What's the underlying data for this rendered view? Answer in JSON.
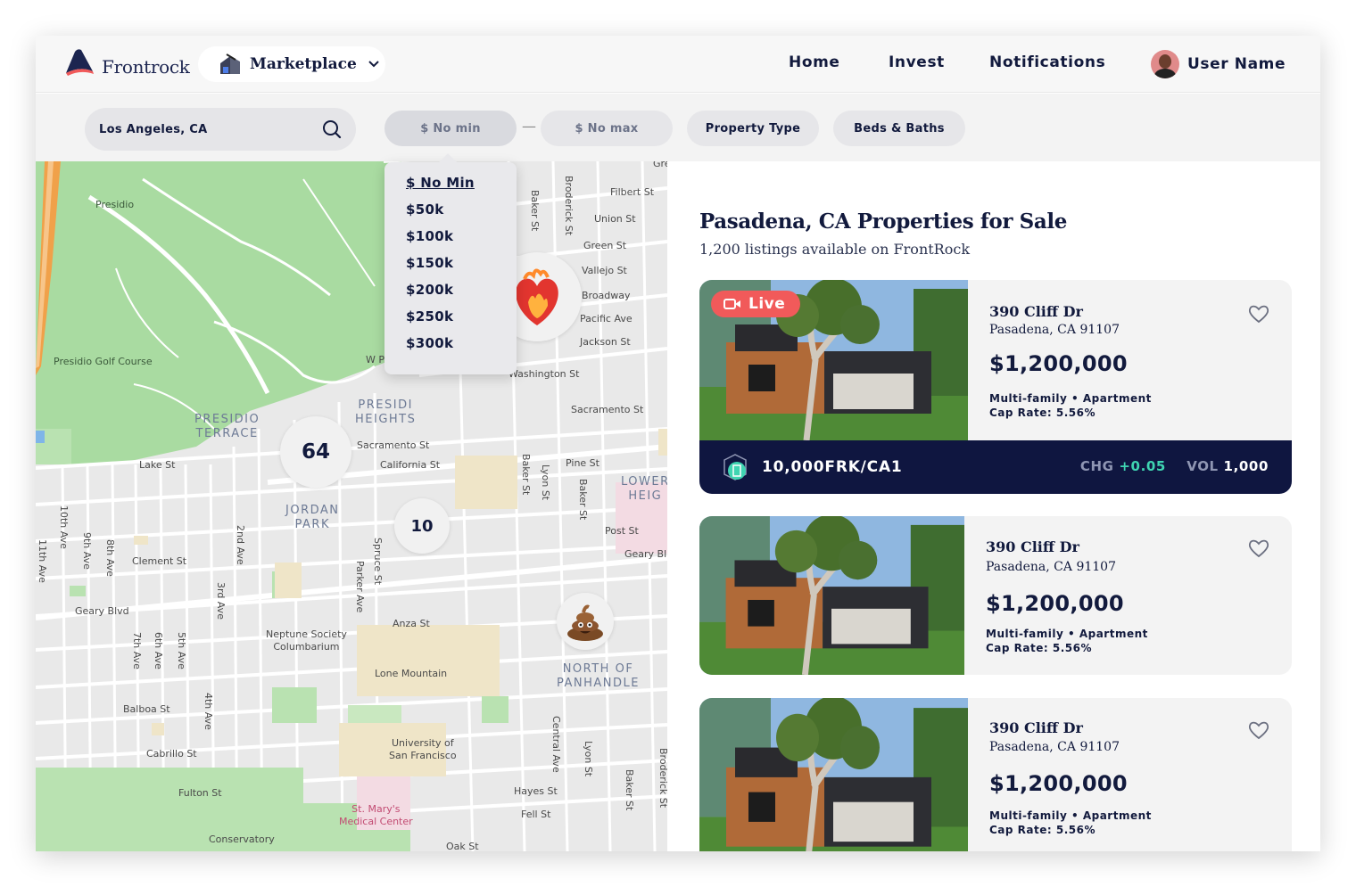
{
  "header": {
    "brand": "Frontrock",
    "marketplace_label": "Marketplace",
    "nav": [
      "Home",
      "Invest",
      "Notifications"
    ],
    "user_name": "User Name"
  },
  "filters": {
    "search_value": "Los Angeles, CA",
    "min_price": "$ No min",
    "max_price": "$ No max",
    "property_type": "Property Type",
    "beds_baths": "Beds & Baths"
  },
  "price_dropdown": {
    "options": [
      "$ No Min",
      "$50k",
      "$100k",
      "$150k",
      "$200k",
      "$250k",
      "$300k"
    ],
    "selected_index": 0
  },
  "map": {
    "clusters": [
      "64",
      "10"
    ],
    "area_labels": {
      "presidio_terrace": "PRESIDIO TERRACE",
      "presidio_heights": "PRESIDIO HEIGHTS",
      "jordan_park": "JORDAN PARK",
      "lower_heights": "LOWER HEIG",
      "north_panhandle": "NORTH OF PANHANDLE"
    },
    "place_labels": {
      "presidio": "Presidio",
      "golf": "Presidio Golf Course",
      "neptune": "Neptune Society Columbarium",
      "lone_mountain": "Lone Mountain",
      "usf": "University of San Francisco",
      "st_marys": "St. Mary's Medical Center",
      "conservatory": "Conservatory"
    },
    "streets": {
      "lake": "Lake St",
      "clement": "Clement St",
      "geary": "Geary Blvd",
      "balboa": "Balboa St",
      "cabrillo": "Cabrillo St",
      "fulton": "Fulton St",
      "california": "California St",
      "sacramento": "Sacramento St",
      "sacramento2": "Sacramento St",
      "washington": "Washington St",
      "jackson": "Jackson St",
      "pacific": "Pacific Ave",
      "broadway": "Broadway",
      "vallejo": "Vallejo St",
      "green": "Green St",
      "union": "Union St",
      "filbert": "Filbert St",
      "pine": "Pine St",
      "post": "Post St",
      "geary2": "Geary Bl",
      "anza": "Anza St",
      "hayes": "Hayes St",
      "fell": "Fell St",
      "oak": "Oak St",
      "wpac": "W P",
      "tenth": "10th Ave",
      "eleventh": "11th Ave",
      "ninth": "9th Ave",
      "eighth": "8th Ave",
      "second": "2nd Ave",
      "third": "3rd Ave",
      "seventh": "7th Ave",
      "sixth": "6th Ave",
      "fifth": "5th Ave",
      "fourth": "4th Ave",
      "spruce": "Spruce St",
      "parker": "Parker Ave",
      "lyon": "Lyon St",
      "baker": "Baker St",
      "lyon2": "Lyon St",
      "baker2": "Baker St",
      "central": "Central Ave",
      "baker3": "Baker St",
      "broderick": "Broderick St",
      "broderick2": "Broderick St",
      "baker_top": "Baker St",
      "gre": "Gre"
    }
  },
  "listings": {
    "title": "Pasadena, CA Properties for Sale",
    "subtitle": "1,200 listings available on FrontRock",
    "items": [
      {
        "live": "Live",
        "address1": "390 Cliff Dr",
        "address2": "Pasadena, CA 91107",
        "price": "$1,200,000",
        "type": "Multi-family • Apartment",
        "cap_rate": "Cap Rate: 5.56%",
        "ticker": "10,000FRK/CA1",
        "chg_label": "CHG",
        "chg_value": "+0.05",
        "vol_label": "VOL",
        "vol_value": "1,000"
      },
      {
        "address1": "390 Cliff Dr",
        "address2": "Pasadena, CA 91107",
        "price": "$1,200,000",
        "type": "Multi-family • Apartment",
        "cap_rate": "Cap Rate: 5.56%"
      },
      {
        "address1": "390 Cliff Dr",
        "address2": "Pasadena, CA 91107",
        "price": "$1,200,000",
        "type": "Multi-family • Apartment",
        "cap_rate": "Cap Rate: 5.56%"
      }
    ]
  },
  "icons": {
    "logo": "frontrock-logo-icon",
    "marketplace": "marketplace-icon",
    "chevron": "chevron-down-icon",
    "search": "search-icon",
    "heart": "heart-icon",
    "live": "video-camera-icon",
    "token": "token-icon",
    "pin_heart": "heart-on-fire-emoji-icon",
    "pin_poop": "poop-emoji-icon"
  },
  "colors": {
    "navy": "#121a3d",
    "ticker_bg": "#0f1640",
    "live_red": "#f15a5a",
    "positive": "#3fd4b1",
    "park_green": "#a8dca0"
  }
}
